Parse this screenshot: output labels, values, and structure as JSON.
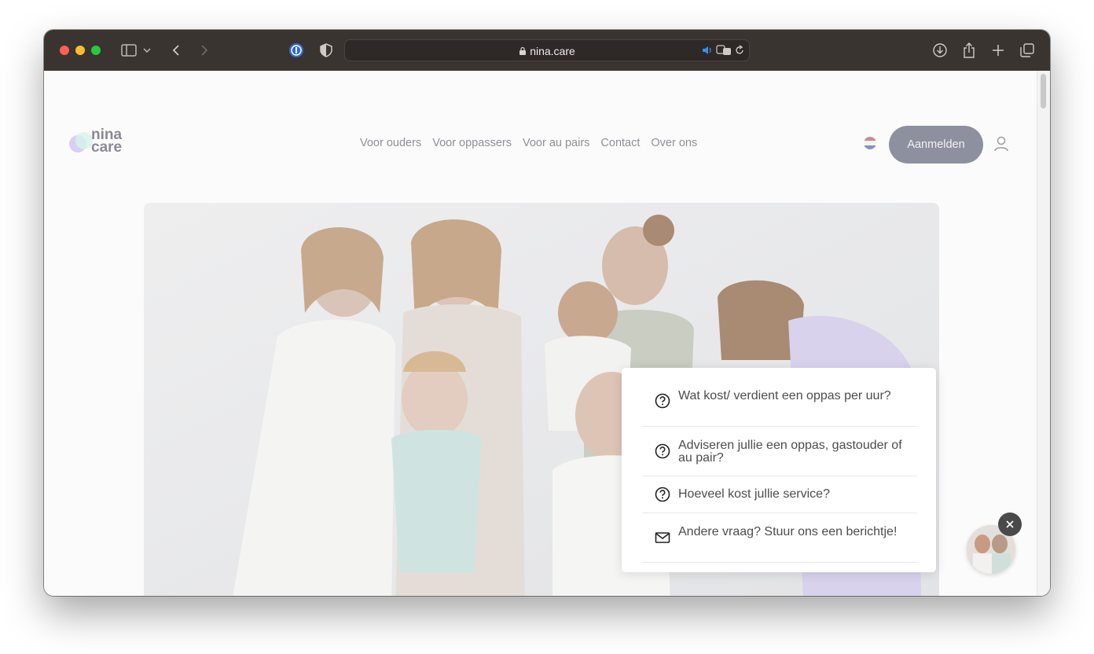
{
  "browser": {
    "url": "nina.care",
    "traffic_light_colors": [
      "#ff5f57",
      "#febc2e",
      "#28c840"
    ]
  },
  "header": {
    "logo_line1": "nina",
    "logo_line2": "care",
    "nav": [
      "Voor ouders",
      "Voor oppassers",
      "Voor au pairs",
      "Contact",
      "Over ons"
    ],
    "language_flag": "netherlands-flag",
    "signup_label": "Aanmelden"
  },
  "faq": {
    "items": [
      {
        "icon": "question-icon",
        "text": "Wat kost/ verdient een oppas per uur?"
      },
      {
        "icon": "question-icon",
        "text": "Adviseren jullie een oppas, gastouder of au pair?"
      },
      {
        "icon": "question-icon",
        "text": "Hoeveel kost jullie service?"
      },
      {
        "icon": "mail-icon",
        "text": "Andere vraag? Stuur ons een berichtje!"
      }
    ]
  },
  "colors": {
    "accent_button": "#8d909e",
    "titlebar": "#3a3430"
  }
}
